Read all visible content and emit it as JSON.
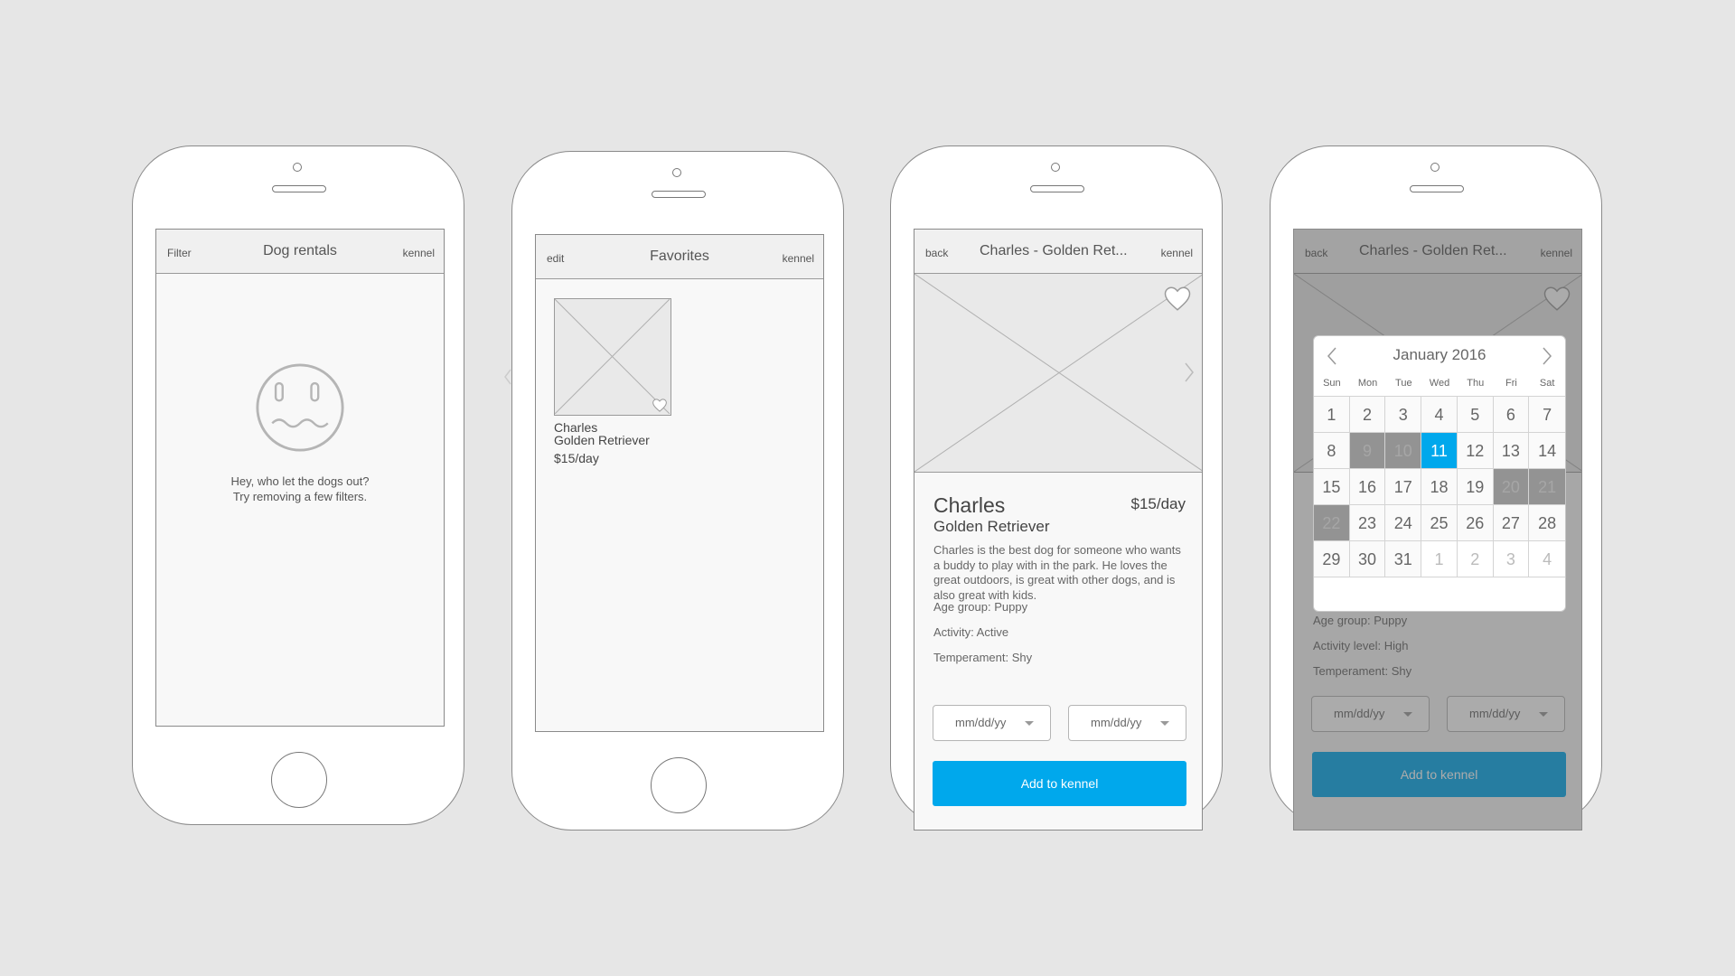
{
  "colors": {
    "background": "#e6e6e6",
    "accent": "#00a8ec",
    "blocked_day": "#939393"
  },
  "screen1": {
    "nav_left": "Filter",
    "title": "Dog rentals",
    "nav_right": "kennel",
    "empty_line1": "Hey, who let the dogs out?",
    "empty_line2": "Try removing a few filters."
  },
  "screen2": {
    "nav_left": "edit",
    "title": "Favorites",
    "nav_right": "kennel",
    "card": {
      "name": "Charles",
      "breed": "Golden Retriever",
      "price": "$15/day"
    }
  },
  "screen3": {
    "nav_left": "back",
    "title": "Charles - Golden Ret...",
    "nav_right": "kennel",
    "name": "Charles",
    "breed": "Golden Retriever",
    "price": "$15/day",
    "description": "Charles is the best dog for someone who wants a buddy to play with in the park. He loves the great outdoors, is great with other dogs, and is also great with kids.",
    "age": "Age group: Puppy",
    "activity": "Activity: Active",
    "temperament": "Temperament: Shy",
    "start_date": "mm/dd/yy",
    "end_date": "mm/dd/yy",
    "cta": "Add to kennel"
  },
  "screen4": {
    "nav_left": "back",
    "title": "Charles - Golden Ret...",
    "nav_right": "kennel",
    "age": "Age group: Puppy",
    "activity": "Activity level: High",
    "temperament": "Temperament: Shy",
    "start_date": "mm/dd/yy",
    "end_date": "mm/dd/yy",
    "cta": "Add to kennel",
    "calendar": {
      "month": "January 2016",
      "weekdays": [
        "Sun",
        "Mon",
        "Tue",
        "Wed",
        "Thu",
        "Fri",
        "Sat"
      ],
      "days": [
        {
          "label": "1",
          "state": "normal"
        },
        {
          "label": "2",
          "state": "normal"
        },
        {
          "label": "3",
          "state": "normal"
        },
        {
          "label": "4",
          "state": "normal"
        },
        {
          "label": "5",
          "state": "normal"
        },
        {
          "label": "6",
          "state": "normal"
        },
        {
          "label": "7",
          "state": "normal"
        },
        {
          "label": "8",
          "state": "normal"
        },
        {
          "label": "9",
          "state": "blocked"
        },
        {
          "label": "10",
          "state": "blocked"
        },
        {
          "label": "11",
          "state": "selected"
        },
        {
          "label": "12",
          "state": "normal"
        },
        {
          "label": "13",
          "state": "normal"
        },
        {
          "label": "14",
          "state": "normal"
        },
        {
          "label": "15",
          "state": "normal"
        },
        {
          "label": "16",
          "state": "normal"
        },
        {
          "label": "17",
          "state": "normal"
        },
        {
          "label": "18",
          "state": "normal"
        },
        {
          "label": "19",
          "state": "normal"
        },
        {
          "label": "20",
          "state": "blocked"
        },
        {
          "label": "21",
          "state": "blocked"
        },
        {
          "label": "22",
          "state": "blocked"
        },
        {
          "label": "23",
          "state": "normal"
        },
        {
          "label": "24",
          "state": "normal"
        },
        {
          "label": "25",
          "state": "normal"
        },
        {
          "label": "26",
          "state": "normal"
        },
        {
          "label": "27",
          "state": "normal"
        },
        {
          "label": "28",
          "state": "normal"
        },
        {
          "label": "29",
          "state": "normal"
        },
        {
          "label": "30",
          "state": "normal"
        },
        {
          "label": "31",
          "state": "normal"
        },
        {
          "label": "1",
          "state": "out"
        },
        {
          "label": "2",
          "state": "out"
        },
        {
          "label": "3",
          "state": "out"
        },
        {
          "label": "4",
          "state": "out"
        }
      ]
    }
  }
}
